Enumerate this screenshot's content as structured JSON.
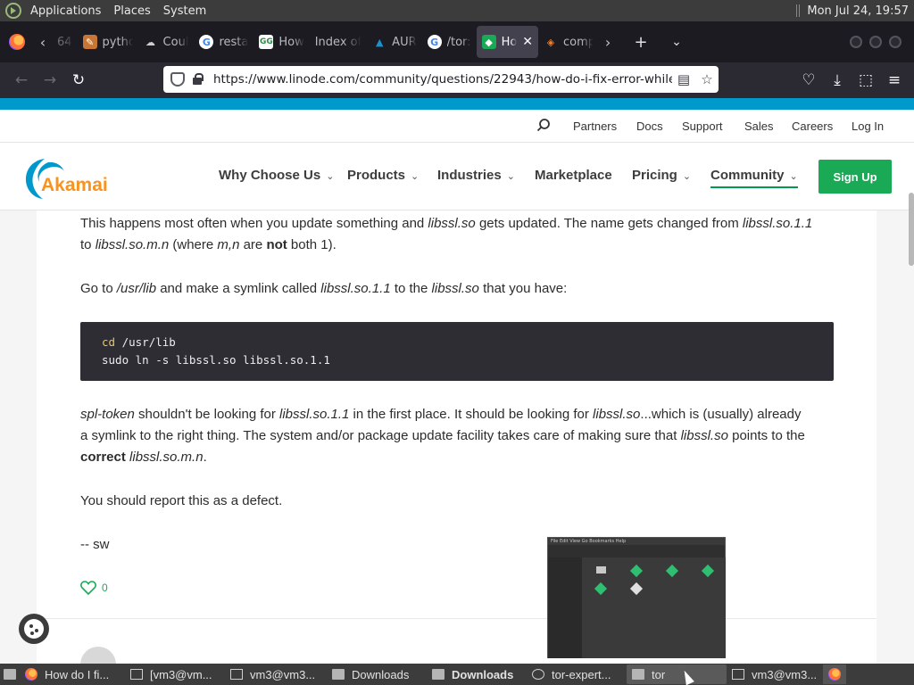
{
  "os_panel": {
    "menus": [
      "Applications",
      "Places",
      "System"
    ],
    "clock": "Mon Jul 24, 19:57"
  },
  "browser": {
    "tabs": [
      {
        "label": "64",
        "icon": "partial-tab-icon"
      },
      {
        "label": "pytho",
        "icon": "python-icon"
      },
      {
        "label": "Coul",
        "icon": "docker-icon"
      },
      {
        "label": "resta",
        "icon": "google-icon"
      },
      {
        "label": "How",
        "icon": "geeksforgeeks-icon"
      },
      {
        "label": "Index of",
        "icon": "none"
      },
      {
        "label": "AUR",
        "icon": "aur-icon"
      },
      {
        "label": "/tor:",
        "icon": "google-icon"
      },
      {
        "label": "Ho",
        "icon": "akamai-icon",
        "active": true
      },
      {
        "label": "comp",
        "icon": "stackoverflow-icon"
      }
    ],
    "url": "https://www.linode.com/community/questions/22943/how-do-i-fix-error-while-"
  },
  "site": {
    "util_links": [
      "Partners",
      "Docs",
      "Support",
      "Sales",
      "Careers",
      "Log In"
    ],
    "logo_text": "Akamai",
    "nav": [
      {
        "label": "Why Choose Us",
        "dropdown": true
      },
      {
        "label": "Products",
        "dropdown": true
      },
      {
        "label": "Industries",
        "dropdown": true
      },
      {
        "label": "Marketplace",
        "dropdown": false
      },
      {
        "label": "Pricing",
        "dropdown": true
      },
      {
        "label": "Community",
        "dropdown": true,
        "active": true
      }
    ],
    "signup": "Sign Up",
    "brand_color": "#1aaa55"
  },
  "answer": {
    "p1": {
      "a": "This happens most often when you update something and ",
      "b": "libssl.so",
      "c": " gets updated. The name gets changed from ",
      "d": "libssl.so.1.1",
      "e": "to ",
      "f": "libssl.so.m.n",
      "g": " (where ",
      "h": "m,n",
      "i": " are ",
      "j": "not",
      "k": " both 1)."
    },
    "p2": {
      "a": "Go to ",
      "b": "/usr/lib",
      "c": " and make a symlink called ",
      "d": "libssl.so.1.1",
      "e": " to the ",
      "f": "libssl.so",
      "g": " that you have:"
    },
    "code": {
      "line1_kw": "cd",
      "line1_rest": " /usr/lib",
      "line2": "sudo ln -s libssl.so libssl.so.1.1"
    },
    "p3": {
      "a": "spl-token",
      "b": " shouldn't be looking for ",
      "c": "libssl.so.1.1",
      "d": " in the first place. It should be looking for ",
      "e": "libssl.so",
      "f": "...which is (usually) already",
      "g": "a symlink to the right thing. The system and/or package update facility takes care of making sure that ",
      "h": "libssl.so",
      "i": " points to the",
      "j": "correct",
      "k": " ",
      "l": "libssl.so.m.n",
      "m": "."
    },
    "p4": "You should report this as a defect.",
    "p5": "-- sw",
    "likes": "0"
  },
  "thumbnail": {
    "menu": "File  Edit  View  Go  Bookmarks  Help"
  },
  "taskbar": [
    {
      "label": "How do I fi...",
      "icon": "firefox-icon",
      "active": true
    },
    {
      "label": "[vm3@vm...",
      "icon": "terminal-icon"
    },
    {
      "label": "vm3@vm3...",
      "icon": "terminal-icon"
    },
    {
      "label": "Downloads",
      "icon": "folder-icon"
    },
    {
      "label": "Downloads",
      "icon": "folder-icon",
      "bold": true
    },
    {
      "label": "tor-expert...",
      "icon": "archive-icon"
    },
    {
      "label": "tor",
      "icon": "folder-icon"
    },
    {
      "label": "vm3@vm3...",
      "icon": "terminal-icon"
    }
  ]
}
